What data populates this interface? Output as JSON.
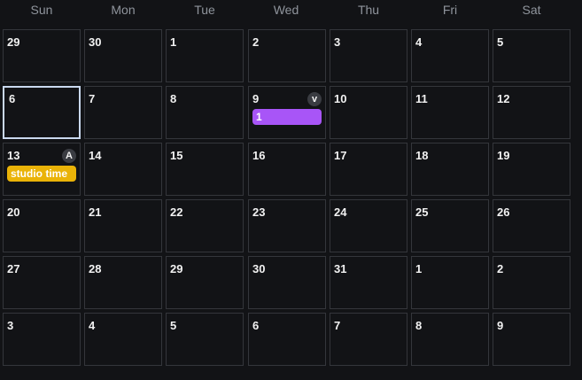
{
  "weekdays": [
    "Sun",
    "Mon",
    "Tue",
    "Wed",
    "Thu",
    "Fri",
    "Sat"
  ],
  "colors": {
    "background": "#121316",
    "cell_border": "#34363b",
    "selected_border": "#c9d8ee",
    "event_purple": "#a855f7",
    "event_yellow": "#eab308"
  },
  "weeks": [
    [
      {
        "day": "29"
      },
      {
        "day": "30"
      },
      {
        "day": "1"
      },
      {
        "day": "2"
      },
      {
        "day": "3"
      },
      {
        "day": "4"
      },
      {
        "day": "5"
      }
    ],
    [
      {
        "day": "6",
        "selected": true
      },
      {
        "day": "7"
      },
      {
        "day": "8"
      },
      {
        "day": "9",
        "avatar": "v",
        "event": {
          "label": "1",
          "color": "#a855f7"
        }
      },
      {
        "day": "10"
      },
      {
        "day": "11"
      },
      {
        "day": "12"
      }
    ],
    [
      {
        "day": "13",
        "avatar": "A",
        "event": {
          "label": "studio time",
          "color": "#eab308"
        }
      },
      {
        "day": "14"
      },
      {
        "day": "15"
      },
      {
        "day": "16"
      },
      {
        "day": "17"
      },
      {
        "day": "18"
      },
      {
        "day": "19"
      }
    ],
    [
      {
        "day": "20"
      },
      {
        "day": "21"
      },
      {
        "day": "22"
      },
      {
        "day": "23"
      },
      {
        "day": "24"
      },
      {
        "day": "25"
      },
      {
        "day": "26"
      }
    ],
    [
      {
        "day": "27"
      },
      {
        "day": "28"
      },
      {
        "day": "29"
      },
      {
        "day": "30"
      },
      {
        "day": "31"
      },
      {
        "day": "1"
      },
      {
        "day": "2"
      }
    ],
    [
      {
        "day": "3"
      },
      {
        "day": "4"
      },
      {
        "day": "5"
      },
      {
        "day": "6"
      },
      {
        "day": "7"
      },
      {
        "day": "8"
      },
      {
        "day": "9"
      }
    ]
  ]
}
